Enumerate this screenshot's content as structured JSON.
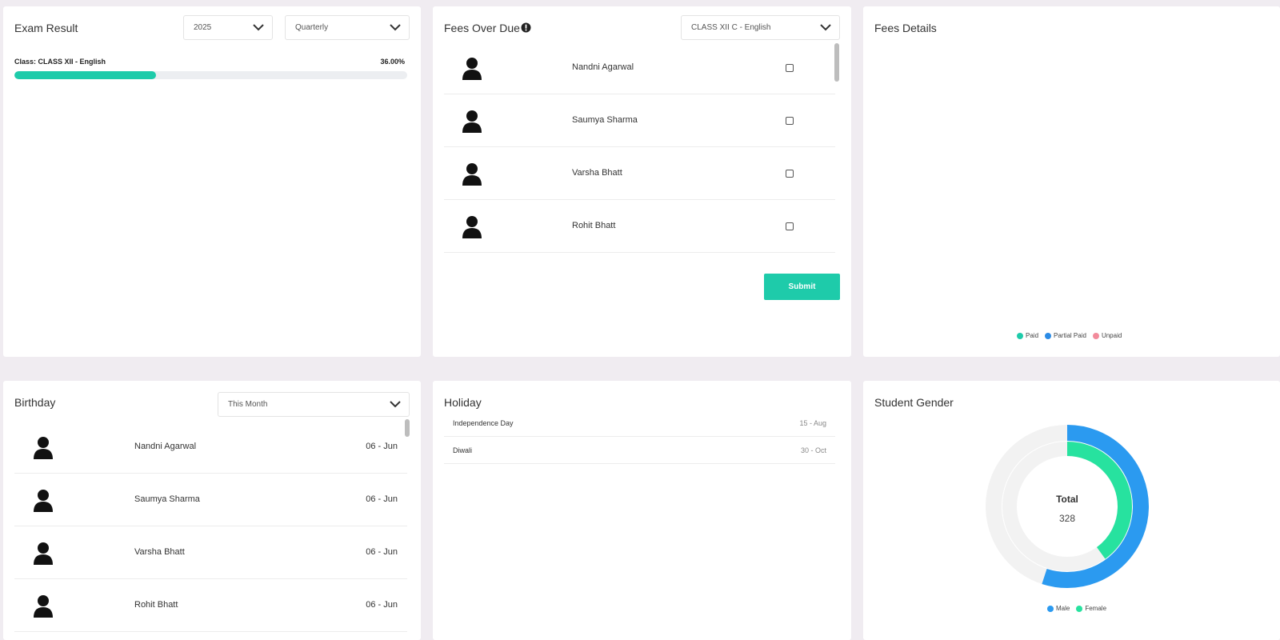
{
  "exam_result": {
    "title": "Exam Result",
    "year_select": "2025",
    "period_select": "Quarterly",
    "class_label": "Class: CLASS XII - English",
    "percent_label": "36.00%",
    "progress": 0.36,
    "progress_color": "#1ecbaa"
  },
  "fees_over_due": {
    "title": "Fees Over Due",
    "info_icon": "info-icon",
    "class_select": "CLASS XII C - English",
    "students": [
      {
        "name": "Nandni Agarwal",
        "checked": false
      },
      {
        "name": "Saumya Sharma",
        "checked": false
      },
      {
        "name": "Varsha Bhatt",
        "checked": false
      },
      {
        "name": "Rohit Bhatt",
        "checked": false
      }
    ],
    "submit_label": "Submit"
  },
  "fees_details": {
    "title": "Fees Details",
    "legend": [
      {
        "label": "Paid",
        "color": "#1ecbaa"
      },
      {
        "label": "Partial Paid",
        "color": "#2b8be5"
      },
      {
        "label": "Unpaid",
        "color": "#f28b9b"
      }
    ]
  },
  "birthday": {
    "title": "Birthday",
    "period_select": "This Month",
    "people": [
      {
        "name": "Nandni Agarwal",
        "date": "06 - Jun"
      },
      {
        "name": "Saumya Sharma",
        "date": "06 - Jun"
      },
      {
        "name": "Varsha Bhatt",
        "date": "06 - Jun"
      },
      {
        "name": "Rohit Bhatt",
        "date": "06 - Jun"
      }
    ]
  },
  "holiday": {
    "title": "Holiday",
    "items": [
      {
        "name": "Independence Day",
        "date": "15 - Aug"
      },
      {
        "name": "Diwali",
        "date": "30 - Oct"
      }
    ]
  },
  "student_gender": {
    "title": "Student Gender",
    "total_label": "Total",
    "total_value": "328",
    "male_fraction": 0.55,
    "female_fraction": 0.4,
    "legend": [
      {
        "label": "Male",
        "color": "#2b9af0"
      },
      {
        "label": "Female",
        "color": "#27e29f"
      }
    ]
  }
}
